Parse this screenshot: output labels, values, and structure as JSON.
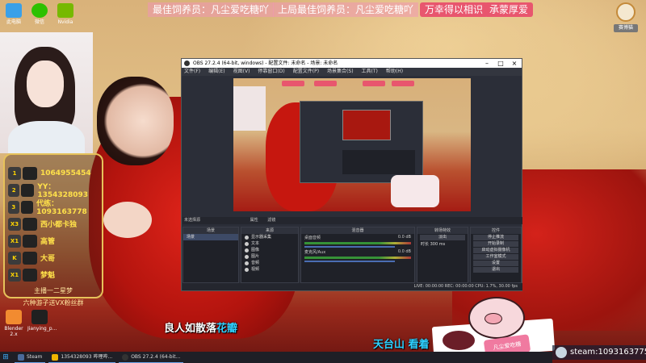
{
  "banners": {
    "best_feeder": "最佳饲养员：凡尘爱吃糖吖",
    "last_best_feeder": "上局最佳饲养员：凡尘爱吃糖吖",
    "blessing": "万幸得以相识",
    "thanks": "承蒙厚爱"
  },
  "desktop_icons": [
    {
      "label": "此电脑",
      "color": "#3aa0e8"
    },
    {
      "label": "微信",
      "color": "#2dc100"
    },
    {
      "label": "Nvidia",
      "color": "#76b900"
    },
    {
      "label": "Blender",
      "color": "#f28b30"
    },
    {
      "label": "剪映",
      "color": "#202020"
    }
  ],
  "desktop_icon_captions": {
    "blender": "Blender 2.x",
    "capcut": "Jianying_p..."
  },
  "leaderboard": {
    "rows": [
      {
        "rank": "1",
        "text": "1064955454"
      },
      {
        "rank": "2",
        "text": "YY：1354328093"
      },
      {
        "rank": "3",
        "text": "代练：1093163778"
      },
      {
        "rank": "X3",
        "text": "西小都卡独"
      },
      {
        "rank": "X1",
        "text": "高管"
      },
      {
        "rank": "K",
        "text": "大哥"
      },
      {
        "rank": "X1",
        "text": "梦魁"
      }
    ],
    "slogan": "主播一二星梦",
    "slogan2": "六种游子送VX粉丝群"
  },
  "obs": {
    "title": "OBS 27.2.4 (64-bit, windows) - 配置文件: 未命名 - 场景: 未命名",
    "menu": [
      "文件(F)",
      "编辑(E)",
      "视图(V)",
      "停靠窗口(D)",
      "配置文件(P)",
      "场景集合(S)",
      "工具(T)",
      "帮助(H)"
    ],
    "scene_label": "未选择源",
    "props_btn": "属性",
    "filters_btn": "滤镜",
    "docks": {
      "scenes": "场景",
      "sources": "来源",
      "mixer": "混音器",
      "transitions": "转场特效",
      "controls": "控件"
    },
    "scene_items": [
      "场景"
    ],
    "source_items": [
      "显示器采集",
      "文本",
      "图像",
      "图片",
      "音频",
      "视频"
    ],
    "mixer_items": [
      {
        "name": "桌面音频",
        "db": "0.0 dB"
      },
      {
        "name": "麦克风/Aux",
        "db": "0.0 dB"
      }
    ],
    "transition": {
      "name": "淡出",
      "duration_label": "时长",
      "duration": "300 ms"
    },
    "controls": [
      "停止推流",
      "开始录制",
      "启动虚拟摄像机",
      "工作室模式",
      "设置",
      "退出"
    ],
    "status": "LIVE: 00:00:00   REC: 00:00:00   CPU: 1.7%, 30.00 fps"
  },
  "lyrics": {
    "line1_white": "良人如散落",
    "line1_blue": "花瓣",
    "line2": "天台山 看着"
  },
  "pig_badge": "凡尘爱吃糖",
  "steam": {
    "text": "steam:1093163775"
  },
  "top_right": {
    "label": "赛博猫"
  },
  "taskbar": {
    "items": [
      {
        "label": "Steam",
        "color": "#4a6a9a"
      },
      {
        "label": "1354328093 哔哩哔...",
        "color": "#f0b400"
      },
      {
        "label": "OBS 27.2.4 (64-bit...",
        "color": "#333"
      }
    ]
  }
}
